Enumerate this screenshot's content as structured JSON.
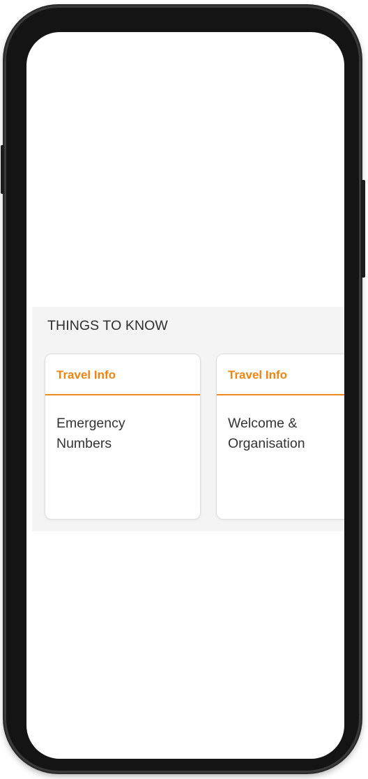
{
  "section": {
    "title": "THINGS TO KNOW"
  },
  "cards": [
    {
      "category": "Travel Info",
      "title": "Emergency\nNumbers"
    },
    {
      "category": "Travel Info",
      "title": "Welcome &\nOrganisation"
    }
  ],
  "colors": {
    "accent": "#ee8512",
    "section_background": "#f4f4f4",
    "frame": "#141414"
  }
}
